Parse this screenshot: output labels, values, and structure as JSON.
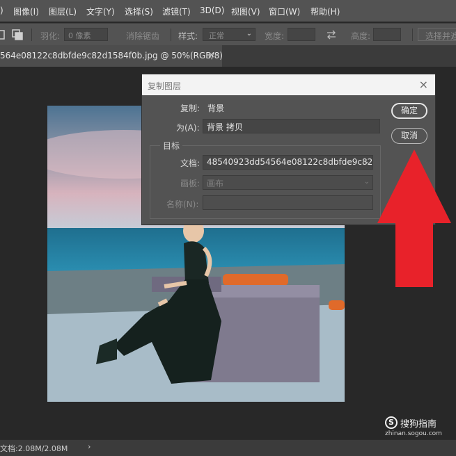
{
  "menu": [
    ")",
    "图像(I)",
    "图层(L)",
    "文字(Y)",
    "选择(S)",
    "滤镜(T)",
    "3D(D)",
    "视图(V)",
    "窗口(W)",
    "帮助(H)"
  ],
  "options": {
    "feather_label": "羽化:",
    "feather_value": "0 像素",
    "antialias_label": "消除锯齿",
    "style_label": "样式:",
    "style_value": "正常",
    "width_label": "宽度:",
    "height_label": "高度:",
    "select_mask_label": "选择并遮"
  },
  "tab": {
    "title": "564e08122c8dbfde9c82d1584f0b.jpg @ 50%(RGB/8)",
    "close": "×"
  },
  "dialog": {
    "title": "复制图层",
    "duplicate_label": "复制:",
    "duplicate_value": "背景",
    "as_label": "为(A):",
    "as_value": "背景 拷贝",
    "target_legend": "目标",
    "document_label": "文档:",
    "document_value": "48540923dd54564e08122c8dbfde9c82...",
    "artboard_label": "画板:",
    "artboard_value": "画布",
    "name_label": "名称(N):",
    "ok_label": "确定",
    "cancel_label": "取消",
    "close": "×"
  },
  "status": {
    "doc_info": "文档:2.08M/2.08M",
    "arrow": "›"
  },
  "watermark": {
    "text": "搜狗指南",
    "url": "zhinan.sogou.com",
    "logo": "S"
  },
  "colors": {
    "annotation_arrow": "#e8222a",
    "menu_bg": "#535353",
    "dialog_bg": "#535353",
    "workspace_bg": "#282828"
  }
}
